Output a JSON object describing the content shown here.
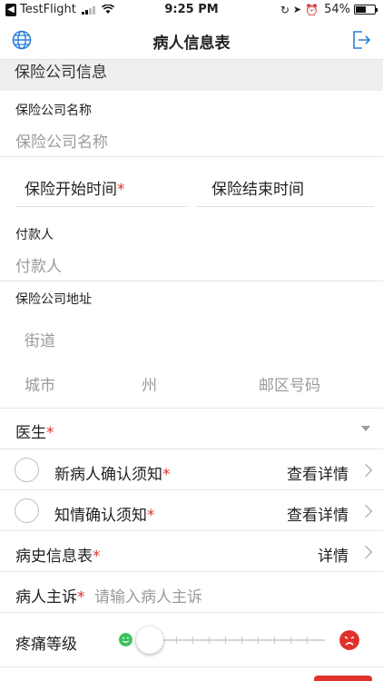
{
  "status_bar": {
    "back_app": "TestFlight",
    "time": "9:25 PM",
    "battery": "54%",
    "battery_level": 0.54
  },
  "nav": {
    "title": "病人信息表",
    "left_icon": "globe-icon",
    "right_icon": "logout-icon"
  },
  "insurance": {
    "section_title": "保险公司信息",
    "company_name_label": "保险公司名称",
    "company_name_placeholder": "保险公司名称",
    "start_date_label": "保险开始时间",
    "start_required": "*",
    "end_date_label": "保险结束时间",
    "payer_label": "付款人",
    "payer_placeholder": "付款人",
    "address_label": "保险公司地址",
    "street_placeholder": "街道",
    "city_placeholder": "城市",
    "state_placeholder": "州",
    "zip_placeholder": "邮区号码"
  },
  "rows": {
    "doctor_label": "医生",
    "doctor_required": "*",
    "new_patient_label": "新病人确认须知",
    "new_patient_required": "*",
    "new_patient_action": "查看详情",
    "consent_label": "知情确认须知",
    "consent_required": "*",
    "consent_action": "查看详情",
    "history_label": "病史信息表",
    "history_required": "*",
    "history_action": "详情",
    "complaint_label": "病人主诉",
    "complaint_required": "*",
    "complaint_placeholder": "请输入病人主诉",
    "pain_label": "疼痛等级",
    "pain_level": 0
  },
  "colors": {
    "required": "#e0322b",
    "accent_blue": "#2b7fd6",
    "happy_face": "#3cc15a",
    "sad_face": "#e0322b"
  }
}
